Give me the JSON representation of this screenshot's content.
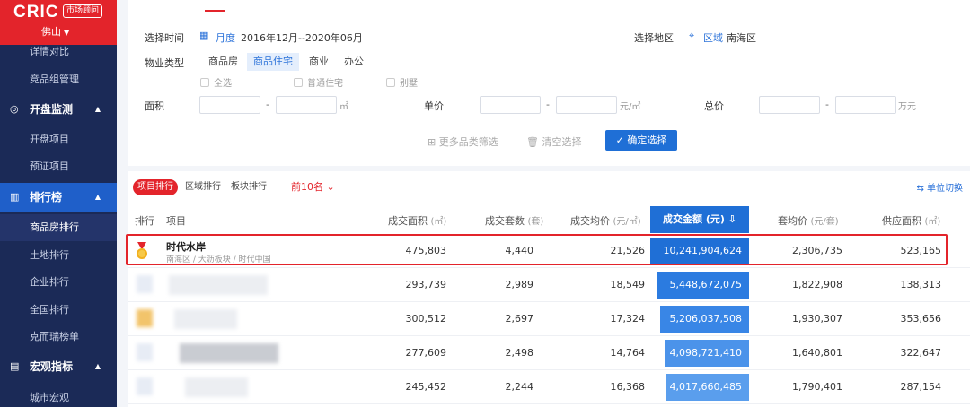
{
  "sidebar": {
    "brand": "CRIC",
    "brand_tag": "市场顾问",
    "city": "佛山",
    "items": [
      {
        "label": "详情对比",
        "type": "item"
      },
      {
        "label": "竞品组管理",
        "type": "item"
      },
      {
        "label": "开盘监测",
        "type": "group",
        "icon": "radar-icon"
      },
      {
        "label": "开盘项目",
        "type": "item"
      },
      {
        "label": "预证项目",
        "type": "item"
      },
      {
        "label": "排行榜",
        "type": "group",
        "icon": "ranking-icon",
        "active": true
      },
      {
        "label": "商品房排行",
        "type": "item",
        "active": true
      },
      {
        "label": "土地排行",
        "type": "item"
      },
      {
        "label": "企业排行",
        "type": "item"
      },
      {
        "label": "全国排行",
        "type": "item"
      },
      {
        "label": "克而瑞榜单",
        "type": "item"
      },
      {
        "label": "宏观指标",
        "type": "group",
        "icon": "chart-icon"
      },
      {
        "label": "城市宏观",
        "type": "item"
      }
    ]
  },
  "filters": {
    "time_label": "选择时间",
    "time_mode": "月度",
    "time_range": "2016年12月--2020年06月",
    "region_label": "选择地区",
    "region_mode": "区域",
    "region_value": "南海区",
    "property_label": "物业类型",
    "property_types": [
      "商品房",
      "商品住宅",
      "商业",
      "办公"
    ],
    "sub_types": [
      "全选",
      "普通住宅",
      "别墅"
    ],
    "area_label": "面积",
    "area_unit": "㎡",
    "unit_price_label": "单价",
    "unit_price_unit": "元/㎡",
    "total_price_label": "总价",
    "total_price_unit": "万元",
    "more_filter": "更多品类筛选",
    "clear_filter": "清空选择",
    "confirm": "确定选择",
    "range_dash": "-"
  },
  "ranking": {
    "tabs": [
      "项目排行",
      "区域排行",
      "板块排行"
    ],
    "top_select": "前10名",
    "unit_switch": "单位切换",
    "columns": {
      "rank": "排行",
      "project": "项目",
      "area": "成交面积",
      "area_unit": "(㎡)",
      "units": "成交套数",
      "units_unit": "(套)",
      "avg_price": "成交均价",
      "avg_price_unit": "(元/㎡)",
      "amount": "成交金额 (元)",
      "unit_avg": "套均价",
      "unit_avg_unit": "(元/套)",
      "supply": "供应面积",
      "supply_unit": "(㎡)"
    },
    "rows": [
      {
        "name": "时代水岸",
        "sub": "南海区 / 大沥板块 / 时代中国",
        "area": "475,803",
        "units": "4,440",
        "avg": "21,526",
        "amount": "10,241,904,624",
        "amount_ratio": 1.0,
        "unit_avg": "2,306,735",
        "supply": "523,165"
      },
      {
        "name": "",
        "sub": "",
        "area": "293,739",
        "units": "2,989",
        "avg": "18,549",
        "amount": "5,448,672,075",
        "amount_ratio": 0.94,
        "unit_avg": "1,822,908",
        "supply": "138,313"
      },
      {
        "name": "",
        "sub": "",
        "area": "300,512",
        "units": "2,697",
        "avg": "17,324",
        "amount": "5,206,037,508",
        "amount_ratio": 0.9,
        "unit_avg": "1,930,307",
        "supply": "353,656"
      },
      {
        "name": "",
        "sub": "",
        "area": "277,609",
        "units": "2,498",
        "avg": "14,764",
        "amount": "4,098,721,410",
        "amount_ratio": 0.85,
        "unit_avg": "1,640,801",
        "supply": "322,647"
      },
      {
        "name": "",
        "sub": "",
        "area": "245,452",
        "units": "2,244",
        "avg": "16,368",
        "amount": "4,017,660,485",
        "amount_ratio": 0.84,
        "unit_avg": "1,790,401",
        "supply": "287,154"
      }
    ]
  },
  "colors": {
    "brand_red": "#e3242b",
    "sidebar_bg": "#1b2a57",
    "accent_blue": "#1f6fd6"
  }
}
